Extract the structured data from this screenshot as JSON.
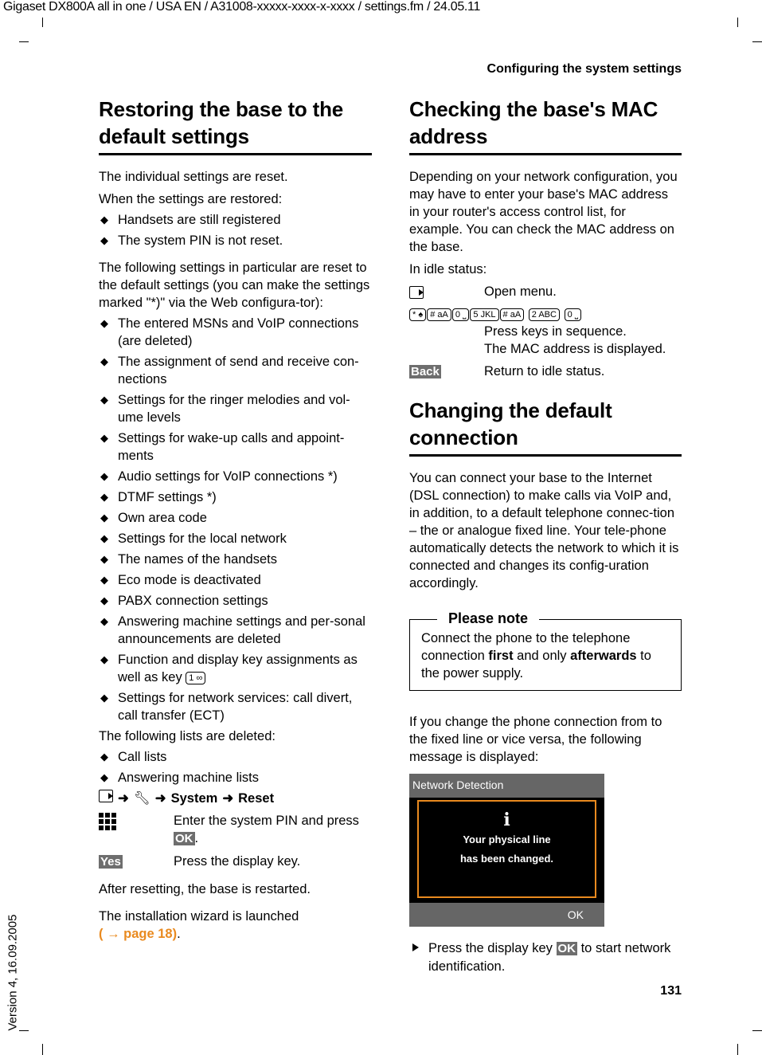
{
  "meta": {
    "doc_id": "Gigaset DX800A all in one / USA EN / A31008-xxxxx-xxxx-x-xxxx / settings.fm / 24.05.11",
    "version": "Version 4, 16.09.2005",
    "running_head": "Configuring the system settings",
    "page_number": "131"
  },
  "left": {
    "title": "Restoring the base to the default settings",
    "intro1": "The individual settings are reset.",
    "intro2": "When the settings are restored:",
    "kept": [
      "Handsets are still registered",
      "The system PIN is not reset."
    ],
    "reset_intro": "The following settings in particular are reset to the default settings (you can make the settings marked \"*)\" via the Web configura-tor):",
    "reset_items": [
      "The entered MSNs and VoIP connections (are deleted)",
      "The assignment of send and receive con-nections",
      "Settings for the ringer melodies and vol-ume levels",
      "Settings for wake-up calls and appoint-ments",
      "Audio settings for VoIP connections *)",
      "DTMF settings *)",
      "Own area code",
      "Settings for the local network",
      "The names of the handsets",
      "Eco mode is deactivated",
      "PABX connection settings",
      "Answering machine settings and per-sonal announcements are deleted"
    ],
    "function_key_item": "Function and display key assignments as well as key",
    "function_key_cap": "1 ∞",
    "network_item": "Settings for network services: call divert, call transfer (ECT)",
    "deleted_intro": "The following lists are deleted:",
    "deleted_items": [
      "Call lists",
      "Answering machine lists"
    ],
    "path": [
      "System",
      "Reset"
    ],
    "steps": [
      {
        "key": "keypad-icon",
        "text_a": "Enter the system PIN and press",
        "softkey": "OK",
        "text_b": "."
      },
      {
        "key": "Yes",
        "text": "Press the display key."
      }
    ],
    "after": "After resetting, the base is restarted.",
    "wizard": "The installation wizard is launched",
    "wizard_link": "( → page 18)",
    "wizard_end": "."
  },
  "right": {
    "title": "Checking the base's MAC address",
    "intro": "Depending on your network configuration, you may have to enter your base's MAC address in your router's access control list, for example. You can check the MAC address on the base.",
    "idle": "In idle status:",
    "open_menu": "Open menu.",
    "key_sequence": [
      "* ♠",
      "# aA",
      "0 ⎵",
      "5 JKL",
      "# aA",
      "2 ABC",
      "0 ⎵"
    ],
    "press_keys": "Press keys in sequence.",
    "displayed": "The MAC address is displayed.",
    "back_label": "Back",
    "back_text": "Return to idle status.",
    "title2": "Changing the default connection",
    "intro2": "You can connect your base to the Internet (DSL connection) to make calls via VoIP and, in addition, to a default telephone connec-tion – the or analogue fixed line. Your tele-phone automatically detects the network to which it is connected and changes its config-uration accordingly.",
    "note": {
      "title": "Please note",
      "a": "Connect the phone to the telephone connection ",
      "b": "first",
      "c": " and only ",
      "d": "afterwards",
      "e": " to the power supply."
    },
    "change_text": "If you change the phone connection from to the fixed line or vice versa, the following message is displayed:",
    "screen": {
      "header": "Network Detection",
      "icon": "i",
      "line1": "Your physical line",
      "line2": "has been changed.",
      "softkey": "OK"
    },
    "final_a": "Press the display key",
    "final_key": "OK",
    "final_b": "to start network identification."
  }
}
